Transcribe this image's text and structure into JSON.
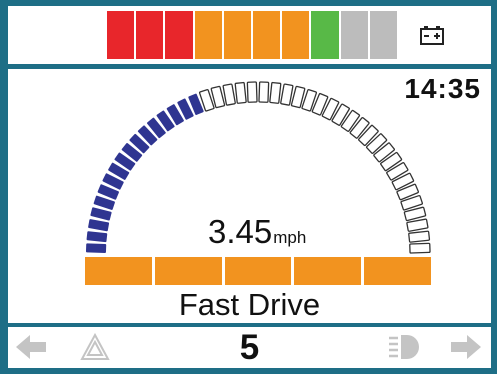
{
  "battery": {
    "icon": "battery-icon",
    "segments": [
      {
        "color": "#e8262b",
        "lit": true
      },
      {
        "color": "#e8262b",
        "lit": true
      },
      {
        "color": "#e8262b",
        "lit": true
      },
      {
        "color": "#f2931f",
        "lit": true
      },
      {
        "color": "#f2931f",
        "lit": true
      },
      {
        "color": "#f2931f",
        "lit": true
      },
      {
        "color": "#f2931f",
        "lit": true
      },
      {
        "color": "#58b947",
        "lit": true
      },
      {
        "color": "#bcbcbc",
        "lit": false
      },
      {
        "color": "#bcbcbc",
        "lit": false
      }
    ]
  },
  "clock": "14:35",
  "speedometer": {
    "lit_fraction": 0.38,
    "lit_color": "#2f3591",
    "speed_value": "3.45",
    "speed_unit": "mph"
  },
  "profile_bar": {
    "segments": 5,
    "color": "#f2931f"
  },
  "drive_mode": "Fast Drive",
  "bottom_bar": {
    "profile_number": "5",
    "icons": [
      "left-arrow-icon",
      "hazard-icon",
      "headlight-icon",
      "right-arrow-icon"
    ],
    "icon_color": "#c4c4c4"
  },
  "colors": {
    "frame": "#1e6e86",
    "background": "#ffffff"
  }
}
